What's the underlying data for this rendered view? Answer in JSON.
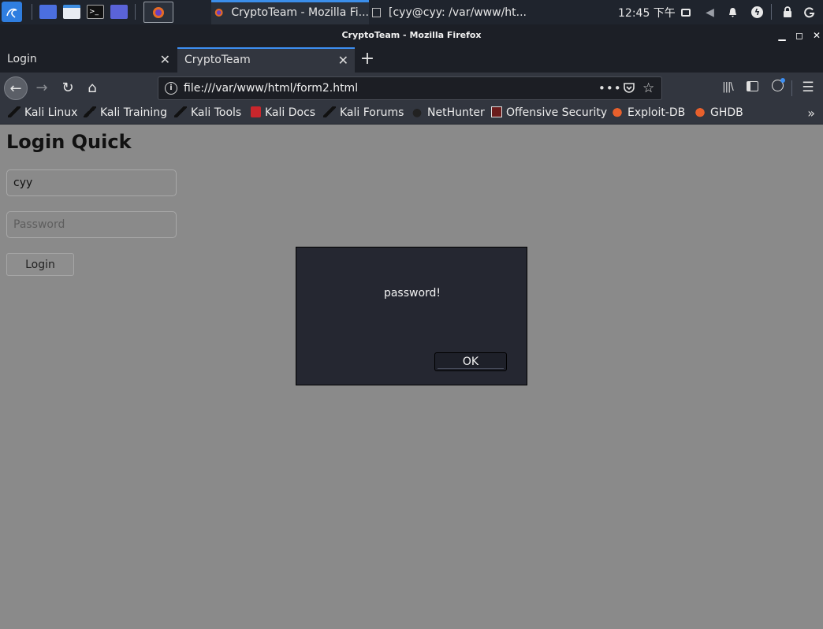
{
  "taskbar": {
    "tasks": [
      {
        "label": "CryptoTeam - Mozilla Fi..."
      },
      {
        "label": "[cyy@cyy: /var/www/ht..."
      }
    ],
    "clock": "12:45 下午"
  },
  "window": {
    "title": "CryptoTeam - Mozilla Firefox"
  },
  "tabs": [
    {
      "label": "Login"
    },
    {
      "label": "CryptoTeam"
    }
  ],
  "navbar": {
    "url": "file:///var/www/html/form2.html"
  },
  "bookmarks": [
    {
      "label": "Kali Linux"
    },
    {
      "label": "Kali Training"
    },
    {
      "label": "Kali Tools"
    },
    {
      "label": "Kali Docs"
    },
    {
      "label": "Kali Forums"
    },
    {
      "label": "NetHunter"
    },
    {
      "label": "Offensive Security"
    },
    {
      "label": "Exploit-DB"
    },
    {
      "label": "GHDB"
    }
  ],
  "page": {
    "title": "Login Quick",
    "username_value": "cyy",
    "password_placeholder": "Password",
    "login_button": "Login"
  },
  "alert": {
    "message": "password!",
    "ok_label": "OK"
  }
}
